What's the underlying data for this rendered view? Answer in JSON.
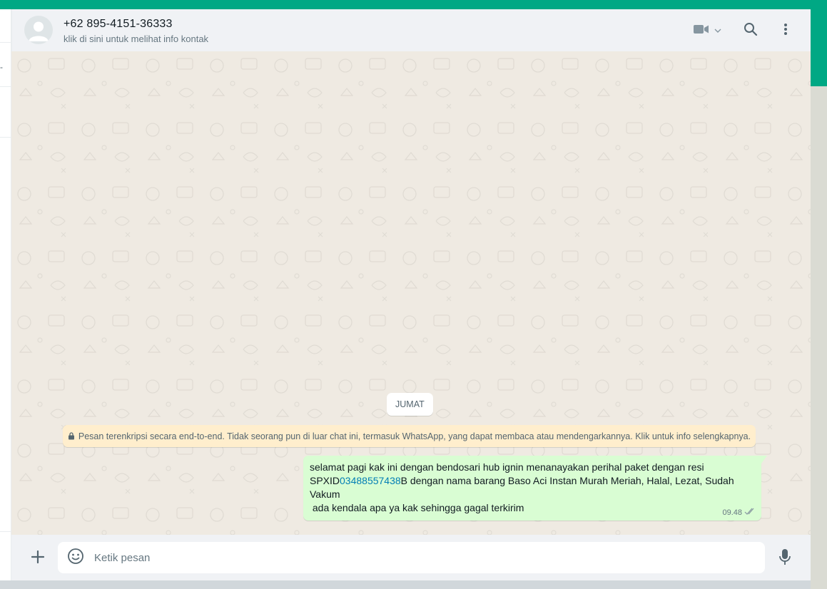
{
  "colors": {
    "accent": "#00a884",
    "outgoing_bubble": "#d9fdd3",
    "notice_bg": "#ffeecd",
    "chat_bg": "#efeae2",
    "link": "#027eb5"
  },
  "header": {
    "contact_name": "+62 895-4151-36333",
    "subtitle": "klik di sini untuk melihat info kontak",
    "icons": [
      "avatar-icon",
      "video-call-icon",
      "chevron-down-icon",
      "search-icon",
      "menu-icon"
    ]
  },
  "sidebar": {
    "partial_glyph": "-"
  },
  "chat": {
    "date_label": "JUMAT",
    "encryption_notice": "Pesan terenkripsi secara end-to-end. Tidak seorang pun di luar chat ini, termasuk WhatsApp, yang dapat membaca atau mendengarkannya. Klik untuk info selengkapnya.",
    "message": {
      "line1": "selamat pagi kak ini dengan bendosari hub ignin menanayakan perihal paket dengan resi",
      "resi_prefix": "SPXID",
      "resi_number": "03488557438",
      "resi_suffix": "B dengan nama barang Baso Aci Instan Murah Meriah, Halal, Lezat, Sudah Vakum",
      "line3": " ada kendala apa ya kak sehingga gagal terkirim",
      "time": "09.48",
      "status": "delivered"
    }
  },
  "footer": {
    "placeholder": "Ketik pesan",
    "value": "",
    "icons": [
      "plus-icon",
      "emoji-icon",
      "microphone-icon"
    ]
  }
}
